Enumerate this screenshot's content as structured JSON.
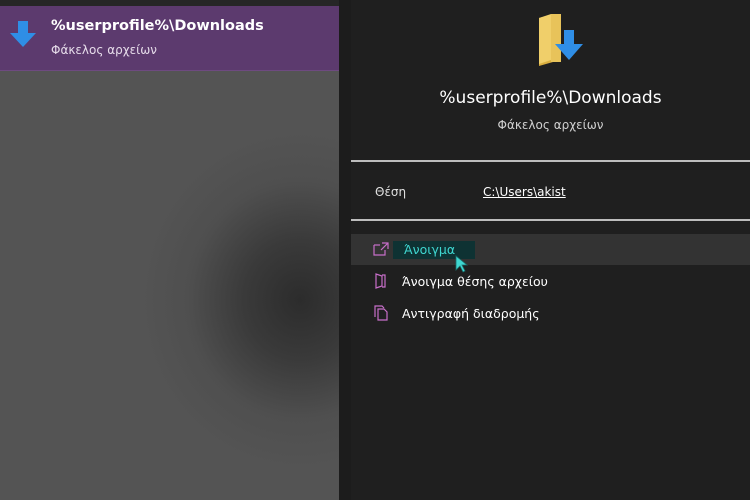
{
  "result": {
    "title": "%userprofile%\\Downloads",
    "subtitle": "Φάκελος αρχείων",
    "icon": "download-arrow-icon"
  },
  "details": {
    "title": "%userprofile%\\Downloads",
    "subtitle": "Φάκελος αρχείων",
    "icon": "downloads-folder-icon",
    "location_label": "Θέση",
    "location_value": "C:\\Users\\akist"
  },
  "actions": [
    {
      "label": "Άνοιγμα",
      "icon": "open-external-icon",
      "highlighted": true
    },
    {
      "label": "Άνοιγμα θέσης αρχείου",
      "icon": "open-location-icon",
      "highlighted": false
    },
    {
      "label": "Αντιγραφή διαδρομής",
      "icon": "copy-icon",
      "highlighted": false
    }
  ],
  "colors": {
    "accent_purple": "#5c3a6e",
    "highlight_text": "#3fd6d0",
    "icon_magenta": "#c86fc9",
    "download_blue": "#2f8ee6",
    "folder_yellow": "#e8c35a"
  }
}
